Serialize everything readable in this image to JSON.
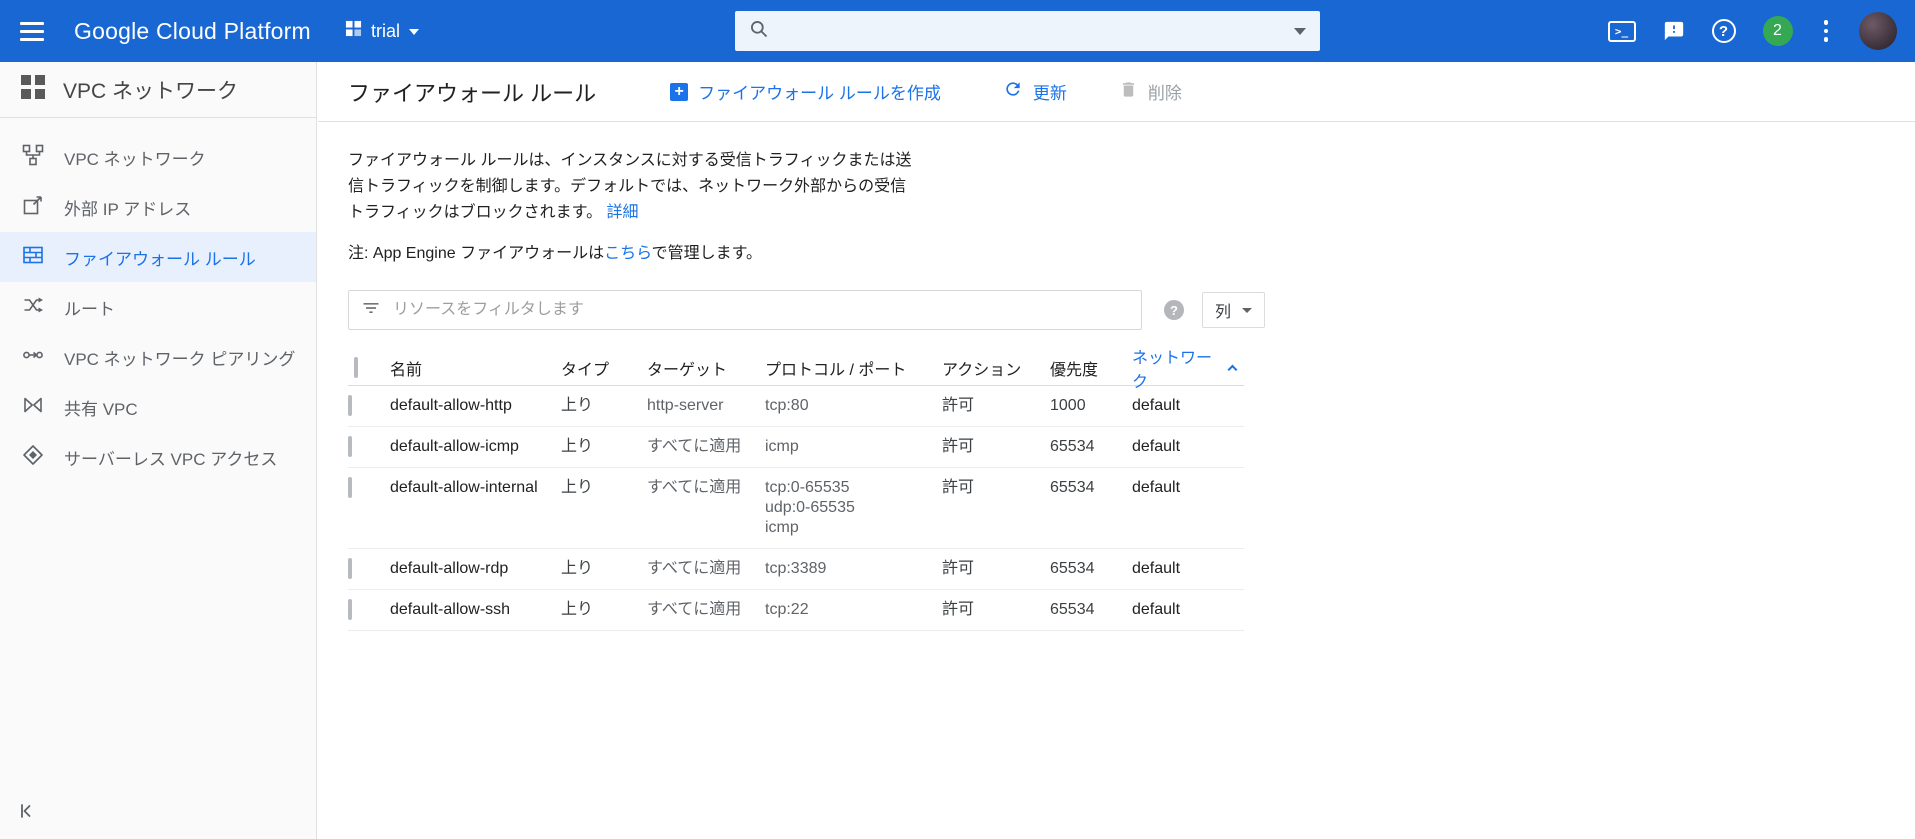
{
  "colors": {
    "header_blue": "#1967d2",
    "link_blue": "#1a73e8",
    "selected_item_bg": "#e8f0fe",
    "notification_green": "#34a853"
  },
  "header": {
    "brand": "Google Cloud Platform",
    "project_name": "trial",
    "search_value": "",
    "notification_count": "2"
  },
  "sidebar": {
    "title": "VPC ネットワーク",
    "items": [
      {
        "label": "VPC ネットワーク"
      },
      {
        "label": "外部 IP アドレス"
      },
      {
        "label": "ファイアウォール ルール"
      },
      {
        "label": "ルート"
      },
      {
        "label": "VPC ネットワーク ピアリング"
      },
      {
        "label": "共有 VPC"
      },
      {
        "label": "サーバーレス VPC アクセス"
      }
    ],
    "selected_index": 2
  },
  "toolbar": {
    "page_title": "ファイアウォール ルール",
    "create_label": "ファイアウォール ルールを作成",
    "refresh_label": "更新",
    "delete_label": "削除"
  },
  "intro": {
    "description": "ファイアウォール ルールは、インスタンスに対する受信トラフィックまたは送信トラフィックを制御します。デフォルトでは、ネットワーク外部からの受信トラフィックはブロックされます。",
    "learn_more_label": "詳細",
    "note_prefix": "注: App Engine ファイアウォールは",
    "note_link_label": "こちら",
    "note_suffix": "で管理します。"
  },
  "filter_bar": {
    "placeholder": "リソースをフィルタします",
    "columns_button_label": "列"
  },
  "table": {
    "columns": [
      "名前",
      "タイプ",
      "ターゲット",
      "プロトコル / ポート",
      "アクション",
      "優先度",
      "ネットワーク"
    ],
    "sort": {
      "column": "ネットワーク",
      "direction": "ascending"
    },
    "rows": [
      {
        "name": "default-allow-http",
        "type": "上り",
        "target": "http-server",
        "protocol": "tcp:80",
        "action": "許可",
        "priority": "1000",
        "network": "default"
      },
      {
        "name": "default-allow-icmp",
        "type": "上り",
        "target": "すべてに適用",
        "protocol": "icmp",
        "action": "許可",
        "priority": "65534",
        "network": "default"
      },
      {
        "name": "default-allow-internal",
        "type": "上り",
        "target": "すべてに適用",
        "protocol": "tcp:0-65535\nudp:0-65535\nicmp",
        "action": "許可",
        "priority": "65534",
        "network": "default"
      },
      {
        "name": "default-allow-rdp",
        "type": "上り",
        "target": "すべてに適用",
        "protocol": "tcp:3389",
        "action": "許可",
        "priority": "65534",
        "network": "default"
      },
      {
        "name": "default-allow-ssh",
        "type": "上り",
        "target": "すべてに適用",
        "protocol": "tcp:22",
        "action": "許可",
        "priority": "65534",
        "network": "default"
      }
    ]
  }
}
